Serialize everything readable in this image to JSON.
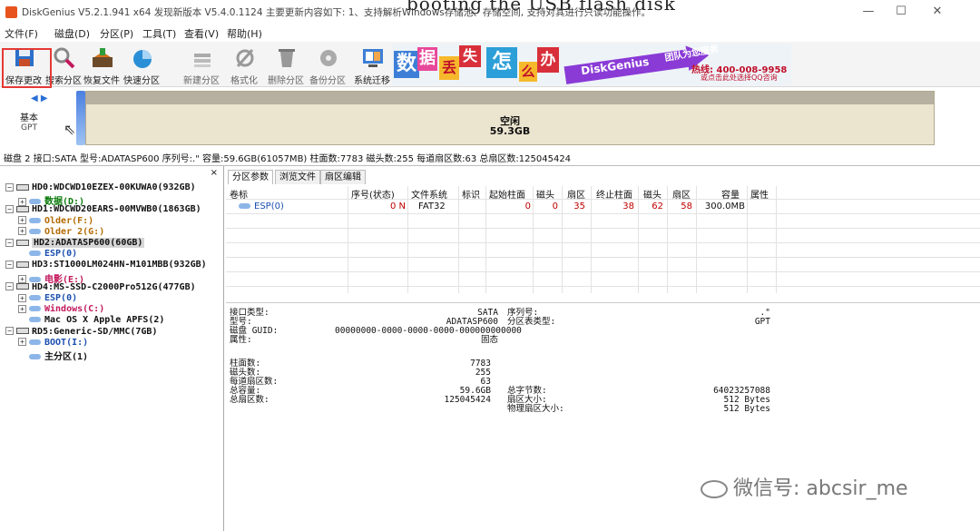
{
  "titlebar": {
    "title": "DiskGenius V5.2.1.941 x64  发现新版本 V5.4.0.1124 主要更新内容如下: 1、支持解析Windows存储池、存储空间, 支持对其进行只读功能操作。",
    "overlay_text": "booting the USB flash disk",
    "minimize": "—",
    "maximize": "☐",
    "close": "✕"
  },
  "menu": [
    "文件(F)",
    "磁盘(D)",
    "分区(P)",
    "工具(T)",
    "查看(V)",
    "帮助(H)"
  ],
  "toolbar": [
    {
      "label": "保存更改",
      "icon": "save-icon",
      "color": "#2c6fc9"
    },
    {
      "label": "搜索分区",
      "icon": "search-icon",
      "color": "#c2185b"
    },
    {
      "label": "恢复文件",
      "icon": "recover-file-icon",
      "color": "#d5731b"
    },
    {
      "label": "快速分区",
      "icon": "quick-partition-icon",
      "color": "#2a8fd6"
    },
    {
      "label": "新建分区",
      "icon": "new-partition-icon",
      "color": "#9a9a9a"
    },
    {
      "label": "格式化",
      "icon": "format-icon",
      "color": "#9a9a9a"
    },
    {
      "label": "删除分区",
      "icon": "delete-partition-icon",
      "color": "#9a9a9a"
    },
    {
      "label": "备份分区",
      "icon": "backup-partition-icon",
      "color": "#9a9a9a"
    },
    {
      "label": "系统迁移",
      "icon": "system-migration-icon",
      "color": "#3d7fd6"
    }
  ],
  "ad": {
    "tiles": [
      "数",
      "据",
      "丢",
      "失",
      "怎",
      "么",
      "办"
    ],
    "brand": "DiskGenius",
    "team": "团队为您服务",
    "phone": "热线: 400-008-9958",
    "qq": "或点击此处选择QQ咨询"
  },
  "diskmap": {
    "nav": "◀ ▶",
    "kind": "基本",
    "scheme": "GPT",
    "free_label": "空闲",
    "free_size": "59.3GB"
  },
  "disk_info": "磁盘 2 接口:SATA  型号:ADATASP600  序列号:.\"  容量:59.6GB(61057MB)  柱面数:7783  磁头数:255  每道扇区数:63  总扇区数:125045424",
  "tree": {
    "close": "×",
    "items": [
      {
        "level": 0,
        "toggle": "−",
        "kind": "disk",
        "text": "HD0:WDCWD10EZEX-00KUWA0(932GB)",
        "color": "#111"
      },
      {
        "level": 1,
        "toggle": "+",
        "kind": "vol",
        "text": "数据(D:)",
        "color": "#0a7a0a"
      },
      {
        "level": 0,
        "toggle": "−",
        "kind": "disk",
        "text": "HD1:WDCWD20EARS-00MVWB0(1863GB)",
        "color": "#111"
      },
      {
        "level": 1,
        "toggle": "+",
        "kind": "vol",
        "text": "Older(F:)",
        "color": "#b36a00"
      },
      {
        "level": 1,
        "toggle": "+",
        "kind": "vol",
        "text": "Older 2(G:)",
        "color": "#b36a00"
      },
      {
        "level": 0,
        "toggle": "−",
        "kind": "disk",
        "text": "HD2:ADATASP600(60GB)",
        "color": "#111",
        "selected": true
      },
      {
        "level": 1,
        "toggle": "",
        "kind": "vol",
        "text": "ESP(0)",
        "color": "#1c4fb0"
      },
      {
        "level": 0,
        "toggle": "−",
        "kind": "disk",
        "text": "HD3:ST1000LM024HN-M101MBB(932GB)",
        "color": "#111"
      },
      {
        "level": 1,
        "toggle": "+",
        "kind": "vol",
        "text": "电影(E:)",
        "color": "#c2185b"
      },
      {
        "level": 0,
        "toggle": "−",
        "kind": "disk",
        "text": "HD4:MS-SSD-C2000Pro512G(477GB)",
        "color": "#111"
      },
      {
        "level": 1,
        "toggle": "+",
        "kind": "vol",
        "text": "ESP(0)",
        "color": "#1c4fb0"
      },
      {
        "level": 1,
        "toggle": "+",
        "kind": "vol",
        "text": "Windows(C:)",
        "color": "#c2185b"
      },
      {
        "level": 1,
        "toggle": "",
        "kind": "vol",
        "text": "Mac OS X Apple APFS(2)",
        "color": "#111"
      },
      {
        "level": 0,
        "toggle": "−",
        "kind": "disk",
        "text": "RD5:Generic-SD/MMC(7GB)",
        "color": "#111"
      },
      {
        "level": 1,
        "toggle": "+",
        "kind": "vol",
        "text": "BOOT(I:)",
        "color": "#1c4fb0"
      },
      {
        "level": 1,
        "toggle": "",
        "kind": "vol",
        "text": "主分区(1)",
        "color": "#111"
      }
    ]
  },
  "tabs": [
    "分区参数",
    "浏览文件",
    "扇区编辑"
  ],
  "ptable": {
    "headers": [
      "卷标",
      "序号(状态)",
      "文件系统",
      "标识",
      "起始柱面",
      "磁头",
      "扇区",
      "终止柱面",
      "磁头",
      "扇区",
      "容量",
      "属性"
    ],
    "rows": [
      [
        "ESP(0)",
        "0 N",
        "FAT32",
        "",
        "0",
        "0",
        "35",
        "38",
        "62",
        "58",
        "300.0MB",
        ""
      ]
    ],
    "number_color": "#c00000"
  },
  "details": {
    "left_labels_1": "接口类型:\n型号:\n磁盘 GUID:\n属性:",
    "left_values_1": "SATA\nADATASP600\n00000000-0000-0000-0000-000000000000\n固态",
    "mid_labels_1": "序列号:\n分区表类型:",
    "right_values_1": ".\"\nGPT",
    "left_labels_2": "柱面数:\n磁头数:\n每道扇区数:\n总容量:\n总扇区数:",
    "left_values_2": "7783\n255\n63\n59.6GB\n125045424",
    "mid_labels_2": "\n\n\n总字节数:\n扇区大小:\n物理扇区大小:",
    "right_values_2": "\n\n\n64023257088\n512 Bytes\n512 Bytes"
  },
  "watermark": "微信号: abcsir_me"
}
